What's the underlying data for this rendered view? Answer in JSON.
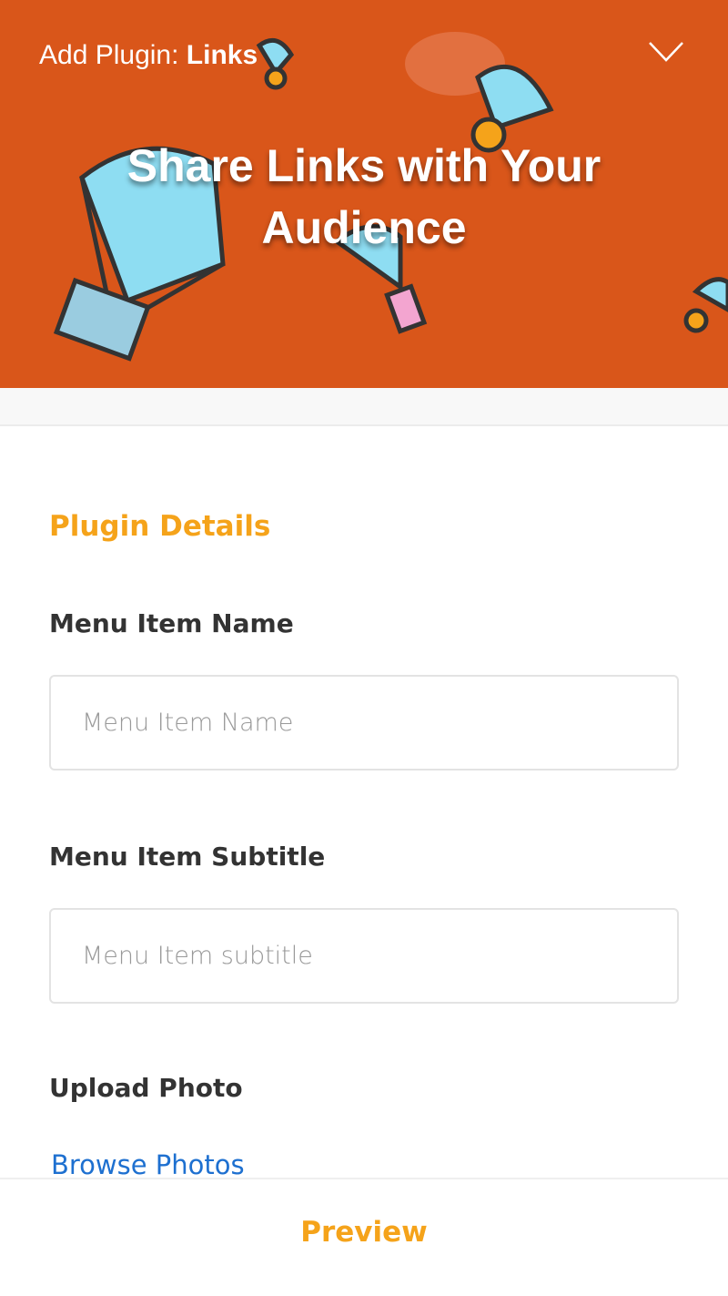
{
  "header": {
    "title_prefix": "Add Plugin: ",
    "title_plugin": "Links",
    "hero_line1": "Share Links with Your",
    "hero_line2": "Audience",
    "banner_color": "#D9561A"
  },
  "form": {
    "section_title": "Plugin Details",
    "name_label": "Menu Item Name",
    "name_placeholder": "Menu Item Name",
    "name_value": "",
    "subtitle_label": "Menu Item Subtitle",
    "subtitle_placeholder": "Menu Item subtitle",
    "subtitle_value": "",
    "photo_label": "Upload Photo",
    "browse_link": "Browse Photos"
  },
  "footer": {
    "preview_label": "Preview"
  },
  "colors": {
    "accent": "#F5A31A",
    "link": "#1E70D0"
  }
}
